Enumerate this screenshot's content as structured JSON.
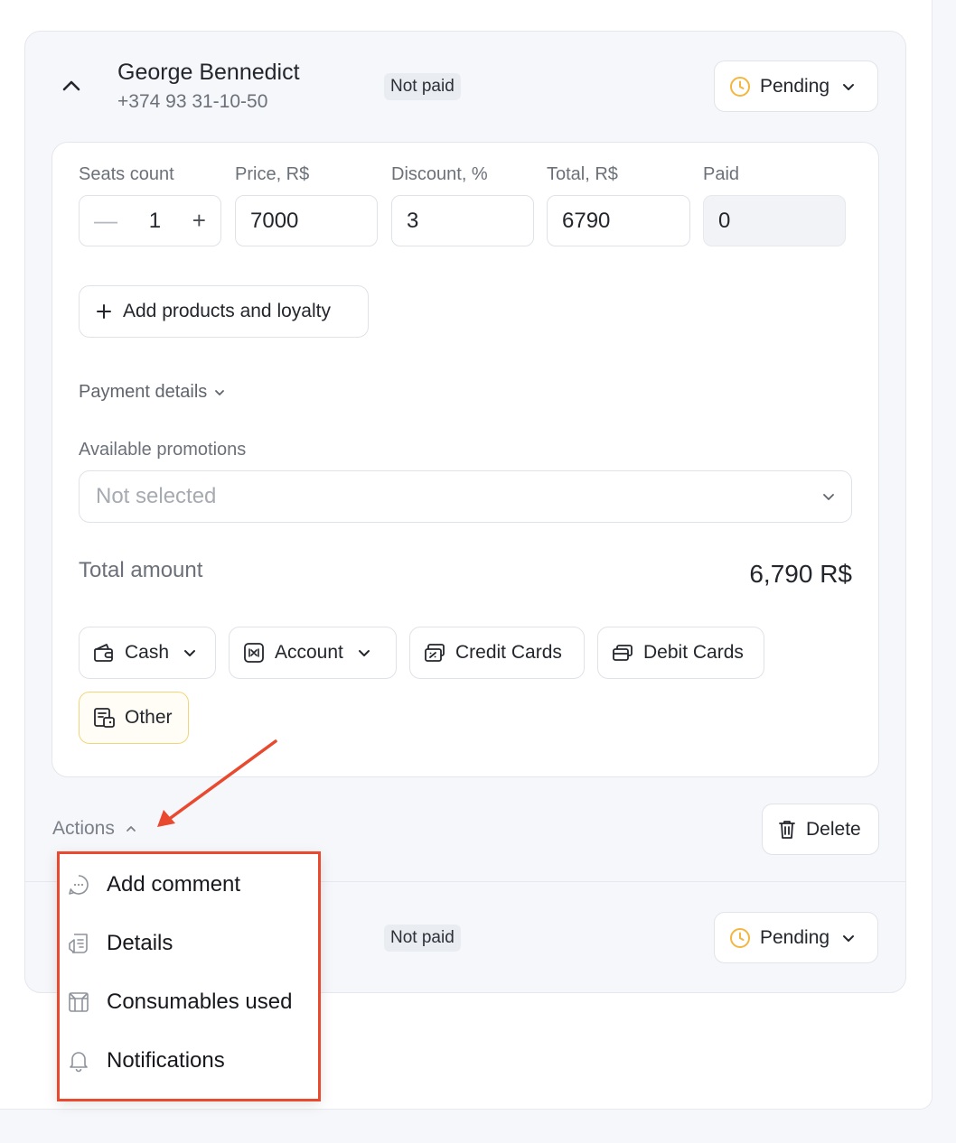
{
  "booking": {
    "client_name": "George Bennedict",
    "client_phone": "+374 93 31-10-50",
    "payment_badge": "Not paid",
    "status": "Pending"
  },
  "fields": {
    "seats_label": "Seats count",
    "seats_value": "1",
    "price_label": "Price, R$",
    "price_value": "7000",
    "discount_label": "Discount, %",
    "discount_value": "3",
    "total_label": "Total, R$",
    "total_value": "6790",
    "paid_label": "Paid",
    "paid_value": "0"
  },
  "add_products_label": "Add products and loyalty",
  "payment_details_label": "Payment details",
  "promotions": {
    "label": "Available promotions",
    "placeholder": "Not selected"
  },
  "total_amount": {
    "label": "Total amount",
    "value": "6,790 R$"
  },
  "payment_methods": [
    {
      "label": "Cash",
      "icon": "wallet-icon"
    },
    {
      "label": "Account",
      "icon": "account-icon"
    },
    {
      "label": "Credit Cards",
      "icon": "credit-card-icon"
    },
    {
      "label": "Debit Cards",
      "icon": "debit-card-icon"
    },
    {
      "label": "Other",
      "icon": "other-payment-icon"
    }
  ],
  "actions_label": "Actions",
  "delete_label": "Delete",
  "second_booking": {
    "payment_badge": "Not paid",
    "status": "Pending"
  },
  "actions_menu": [
    {
      "label": "Add comment",
      "icon": "comment-icon"
    },
    {
      "label": "Details",
      "icon": "details-icon"
    },
    {
      "label": "Consumables used",
      "icon": "consumables-icon"
    },
    {
      "label": "Notifications",
      "icon": "bell-icon"
    }
  ],
  "colors": {
    "accent_pending": "#f4b63f",
    "annotation_red": "#e8492f",
    "selected_border": "#f2d57a"
  }
}
